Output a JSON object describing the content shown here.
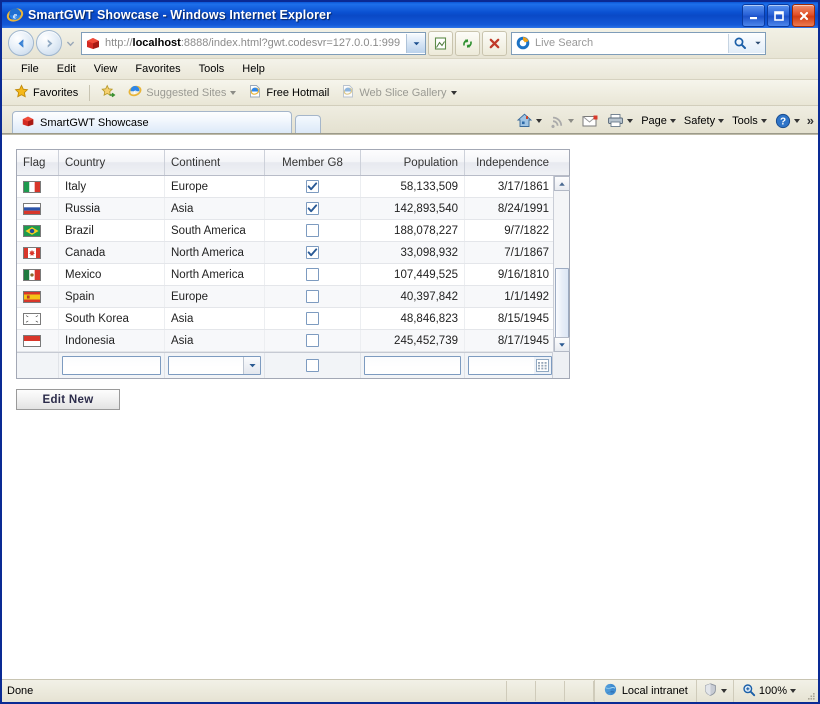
{
  "window": {
    "title": "SmartGWT Showcase - Windows Internet Explorer",
    "app_icon": "internet-explorer-icon",
    "minimize_label": "Minimize",
    "maximize_label": "Maximize",
    "close_label": "Close"
  },
  "nav": {
    "back_label": "Back",
    "forward_label": "Forward",
    "recent_pages_label": "Recent Pages",
    "address": {
      "scheme": "http://",
      "host": "localhost",
      "rest": ":8888/index.html?gwt.codesvr=127.0.0.1:999",
      "full": "http://localhost:8888/index.html?gwt.codesvr=127.0.0.1:999",
      "favicon": "smartgwt-icon"
    },
    "compat_label": "Compatibility View",
    "refresh_label": "Refresh",
    "stop_label": "Stop",
    "search": {
      "placeholder": "Live Search",
      "provider_icon": "bing-icon",
      "go_label": "Search",
      "options_label": "Search Options"
    }
  },
  "menu": {
    "items": [
      {
        "label": "File"
      },
      {
        "label": "Edit"
      },
      {
        "label": "View"
      },
      {
        "label": "Favorites"
      },
      {
        "label": "Tools"
      },
      {
        "label": "Help"
      }
    ]
  },
  "favorites_bar": {
    "favorites_label": "Favorites",
    "add_label": "Add to Favorites Bar",
    "items": [
      {
        "label": "Suggested Sites",
        "icon": "ie-icon",
        "dim": true,
        "caret": true
      },
      {
        "label": "Free Hotmail",
        "icon": "page-icon",
        "dim": false,
        "caret": false
      },
      {
        "label": "Web Slice Gallery",
        "icon": "page-icon",
        "dim": true,
        "caret": true
      }
    ]
  },
  "tabs": {
    "items": [
      {
        "label": "SmartGWT Showcase",
        "icon": "smartgwt-icon",
        "active": true
      }
    ],
    "new_tab_label": "New Tab"
  },
  "command_bar": {
    "home_label": "Home",
    "feeds_label": "Feeds",
    "mail_label": "Read Mail",
    "print_label": "Print",
    "items": [
      {
        "label": "Page"
      },
      {
        "label": "Safety"
      },
      {
        "label": "Tools"
      }
    ],
    "help_label": "Help",
    "overflow_label": "»"
  },
  "grid": {
    "columns": [
      {
        "key": "flag",
        "label": "Flag",
        "align": "left"
      },
      {
        "key": "country",
        "label": "Country",
        "align": "left"
      },
      {
        "key": "continent",
        "label": "Continent",
        "align": "left"
      },
      {
        "key": "g8",
        "label": "Member G8",
        "align": "center"
      },
      {
        "key": "population",
        "label": "Population",
        "align": "right"
      },
      {
        "key": "independence",
        "label": "Independence",
        "align": "right"
      }
    ],
    "rows": [
      {
        "flag": "italy-flag",
        "country": "Italy",
        "continent": "Europe",
        "g8": true,
        "population": "58,133,509",
        "independence": "3/17/1861"
      },
      {
        "flag": "russia-flag",
        "country": "Russia",
        "continent": "Asia",
        "g8": true,
        "population": "142,893,540",
        "independence": "8/24/1991"
      },
      {
        "flag": "brazil-flag",
        "country": "Brazil",
        "continent": "South America",
        "g8": false,
        "population": "188,078,227",
        "independence": "9/7/1822"
      },
      {
        "flag": "canada-flag",
        "country": "Canada",
        "continent": "North America",
        "g8": true,
        "population": "33,098,932",
        "independence": "7/1/1867"
      },
      {
        "flag": "mexico-flag",
        "country": "Mexico",
        "continent": "North America",
        "g8": false,
        "population": "107,449,525",
        "independence": "9/16/1810"
      },
      {
        "flag": "spain-flag",
        "country": "Spain",
        "continent": "Europe",
        "g8": false,
        "population": "40,397,842",
        "independence": "1/1/1492"
      },
      {
        "flag": "southkorea-flag",
        "country": "South Korea",
        "continent": "Asia",
        "g8": false,
        "population": "48,846,823",
        "independence": "8/15/1945"
      },
      {
        "flag": "indonesia-flag",
        "country": "Indonesia",
        "continent": "Asia",
        "g8": false,
        "population": "245,452,739",
        "independence": "8/17/1945"
      }
    ],
    "new_row": {
      "country_value": "",
      "continent_value": "",
      "g8_checked": false,
      "population_value": "",
      "independence_value": "",
      "continent_picker_icon": "chevron-down-icon",
      "independence_picker_icon": "calendar-icon"
    },
    "scrollbar": {
      "up_label": "Scroll Up",
      "down_label": "Scroll Down"
    }
  },
  "actions": {
    "edit_new_label": "Edit New"
  },
  "status_bar": {
    "message": "Done",
    "zone_label": "Local intranet",
    "zone_icon": "globe-icon",
    "protected_icon": "protected-mode-icon",
    "zoom_icon": "zoom-icon",
    "zoom_level": "100%"
  },
  "colors": {
    "title_blue": "#0A4FD0",
    "chrome_tan": "#ECE9D8",
    "grid_header": "#EFF1F5",
    "accent_border": "#7D9BC0"
  }
}
